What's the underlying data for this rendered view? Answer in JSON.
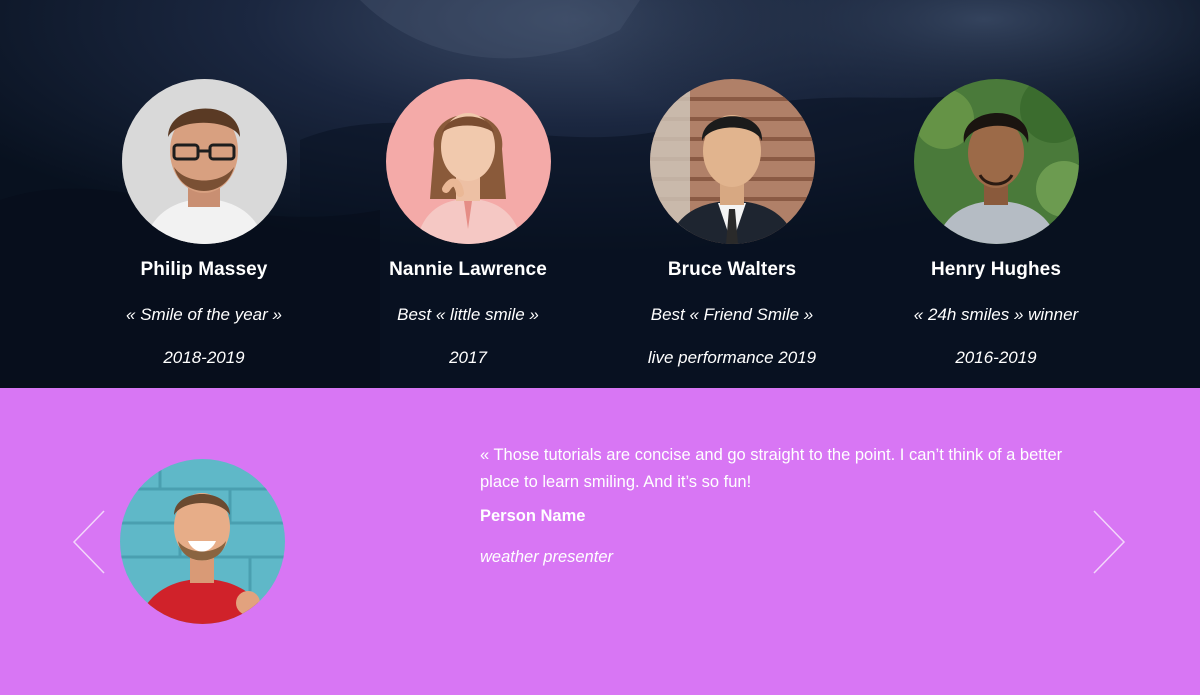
{
  "team": {
    "members": [
      {
        "name": "Philip Massey",
        "award": "« Smile of the year »",
        "years": "2018-2019"
      },
      {
        "name": "Nannie Lawrence",
        "award": "Best « little smile »",
        "years": "2017"
      },
      {
        "name": "Bruce Walters",
        "award": "Best « Friend Smile »",
        "years": "live performance 2019"
      },
      {
        "name": "Henry Hughes",
        "award": "« 24h smiles » winner",
        "years": "2016-2019"
      }
    ]
  },
  "testimonial": {
    "quote": "« Those tutorials are concise and go straight to the point. I can’t think of a better place to learn smiling. And it’s so fun!",
    "name": "Person Name",
    "role": "weather presenter"
  },
  "nav": {
    "prev_icon": "chevron-left-icon",
    "next_icon": "chevron-right-icon"
  },
  "colors": {
    "team_bg": "#0b1528",
    "testimonial_bg": "#d876f4",
    "text": "#ffffff"
  }
}
